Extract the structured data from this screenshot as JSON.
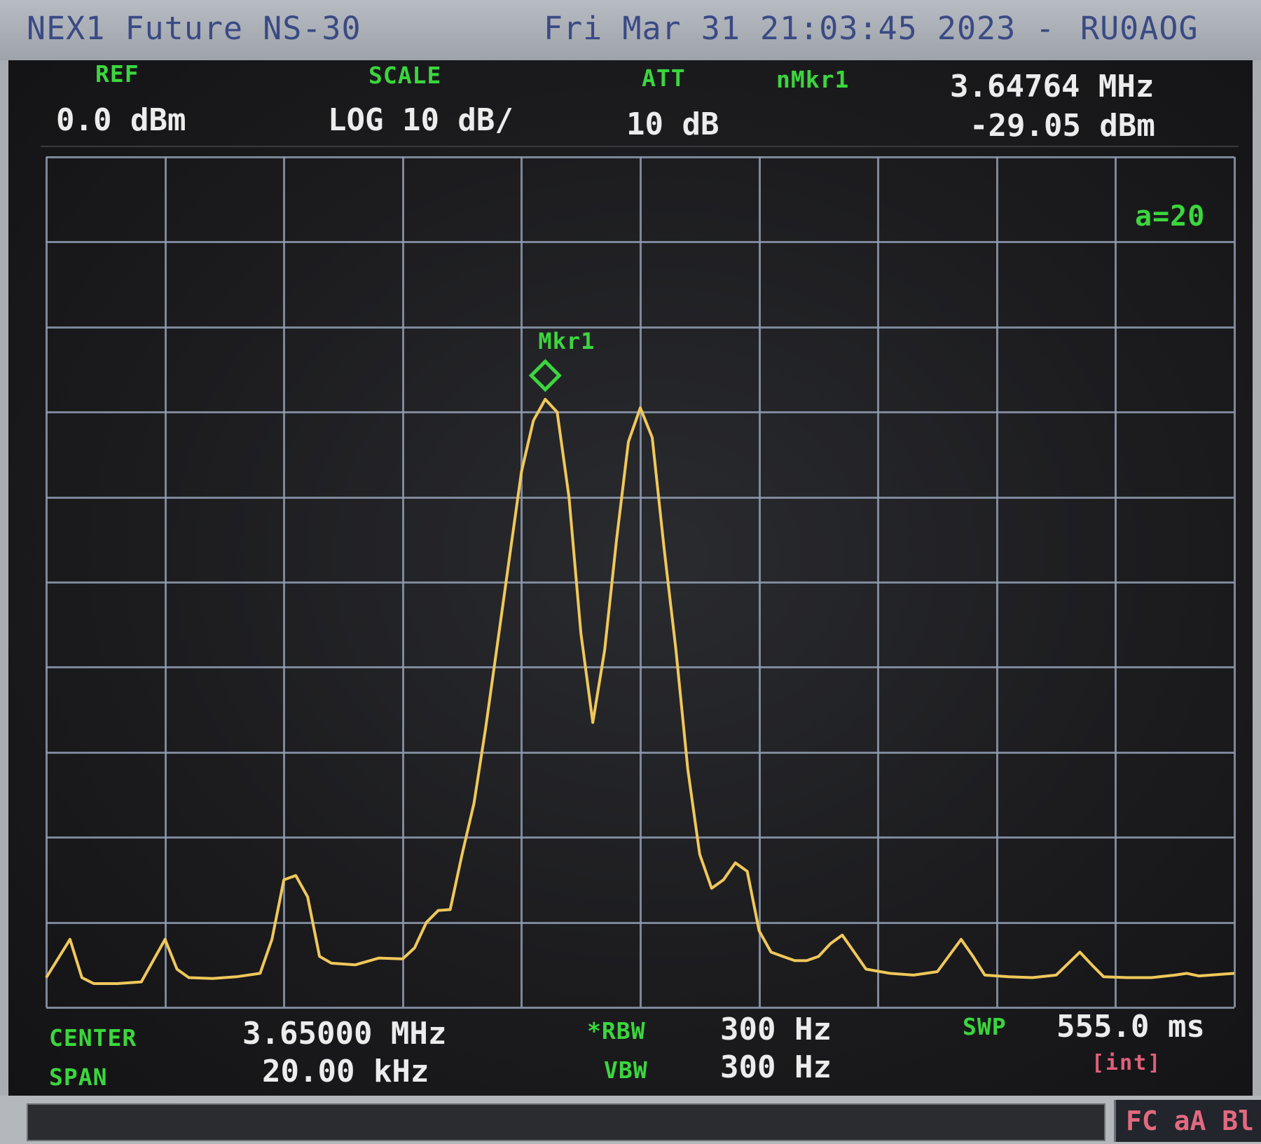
{
  "titlebar": {
    "device": "NEX1 Future NS-30",
    "datetime": "Fri Mar 31 21:03:45 2023 -",
    "callsign": "RU0AOG"
  },
  "header": {
    "ref_label": "REF",
    "ref_value": "0.0 dBm",
    "scale_label": "SCALE",
    "scale_value": "LOG 10 dB/",
    "att_label": "ATT",
    "att_value": "10 dB",
    "nmkr_label": "nMkr1",
    "marker_freq": "3.64764 MHz",
    "marker_level": "-29.05 dBm",
    "avg": "a=20"
  },
  "marker": {
    "label": "Mkr1"
  },
  "footer": {
    "center_label": "CENTER",
    "center_value": "3.65000 MHz",
    "span_label": "SPAN",
    "span_value": "20.00 kHz",
    "rbw_label": "*RBW",
    "rbw_value": "300 Hz",
    "vbw_label": "VBW",
    "vbw_value": "300 Hz",
    "swp_label": "SWP",
    "swp_value": "555.0 ms",
    "swp_mode": "[int]"
  },
  "indicators": "FC aA Bl",
  "colors": {
    "trace": "#f0c85a",
    "label": "#3bd63e",
    "marker": "#3bd63e",
    "grid": "#8f9bb0"
  },
  "trace": {
    "x_khz_offset_range": [
      -10,
      10
    ],
    "ref_dbm": 0,
    "db_per_div": 10,
    "points": [
      [
        -10.0,
        -96.5
      ],
      [
        -9.6,
        -92.0
      ],
      [
        -9.4,
        -96.5
      ],
      [
        -9.2,
        -97.2
      ],
      [
        -8.8,
        -97.2
      ],
      [
        -8.4,
        -97.0
      ],
      [
        -8.0,
        -92.0
      ],
      [
        -7.8,
        -95.5
      ],
      [
        -7.6,
        -96.5
      ],
      [
        -7.2,
        -96.6
      ],
      [
        -6.8,
        -96.4
      ],
      [
        -6.4,
        -96.0
      ],
      [
        -6.2,
        -92.0
      ],
      [
        -6.0,
        -85.0
      ],
      [
        -5.8,
        -84.5
      ],
      [
        -5.6,
        -87.0
      ],
      [
        -5.4,
        -94.0
      ],
      [
        -5.2,
        -94.8
      ],
      [
        -4.8,
        -95.0
      ],
      [
        -4.4,
        -94.2
      ],
      [
        -4.0,
        -94.3
      ],
      [
        -3.8,
        -93.0
      ],
      [
        -3.6,
        -90.0
      ],
      [
        -3.4,
        -88.6
      ],
      [
        -3.2,
        -88.5
      ],
      [
        -3.0,
        -82.0
      ],
      [
        -2.8,
        -76.0
      ],
      [
        -2.6,
        -67.0
      ],
      [
        -2.4,
        -57.0
      ],
      [
        -2.2,
        -47.0
      ],
      [
        -2.0,
        -37.0
      ],
      [
        -1.8,
        -31.0
      ],
      [
        -1.6,
        -28.5
      ],
      [
        -1.4,
        -30.0
      ],
      [
        -1.2,
        -40.0
      ],
      [
        -1.0,
        -56.0
      ],
      [
        -0.8,
        -66.5
      ],
      [
        -0.6,
        -58.0
      ],
      [
        -0.4,
        -45.0
      ],
      [
        -0.2,
        -33.5
      ],
      [
        0.0,
        -29.5
      ],
      [
        0.2,
        -33.0
      ],
      [
        0.4,
        -46.0
      ],
      [
        0.6,
        -58.0
      ],
      [
        0.8,
        -72.0
      ],
      [
        1.0,
        -82.0
      ],
      [
        1.2,
        -86.0
      ],
      [
        1.4,
        -85.0
      ],
      [
        1.6,
        -83.0
      ],
      [
        1.8,
        -84.0
      ],
      [
        2.0,
        -91.0
      ],
      [
        2.2,
        -93.5
      ],
      [
        2.4,
        -94.0
      ],
      [
        2.6,
        -94.5
      ],
      [
        2.8,
        -94.5
      ],
      [
        3.0,
        -94.0
      ],
      [
        3.2,
        -92.5
      ],
      [
        3.4,
        -91.5
      ],
      [
        3.6,
        -93.5
      ],
      [
        3.8,
        -95.5
      ],
      [
        4.2,
        -96.0
      ],
      [
        4.6,
        -96.2
      ],
      [
        5.0,
        -95.8
      ],
      [
        5.4,
        -92.0
      ],
      [
        5.6,
        -94.0
      ],
      [
        5.8,
        -96.2
      ],
      [
        6.2,
        -96.4
      ],
      [
        6.6,
        -96.5
      ],
      [
        7.0,
        -96.2
      ],
      [
        7.4,
        -93.5
      ],
      [
        7.6,
        -95.0
      ],
      [
        7.8,
        -96.4
      ],
      [
        8.2,
        -96.5
      ],
      [
        8.6,
        -96.5
      ],
      [
        9.0,
        -96.2
      ],
      [
        9.2,
        -96.0
      ],
      [
        9.4,
        -96.3
      ],
      [
        10.0,
        -96.0
      ]
    ],
    "marker_point": [
      -1.6,
      -28.5
    ]
  }
}
